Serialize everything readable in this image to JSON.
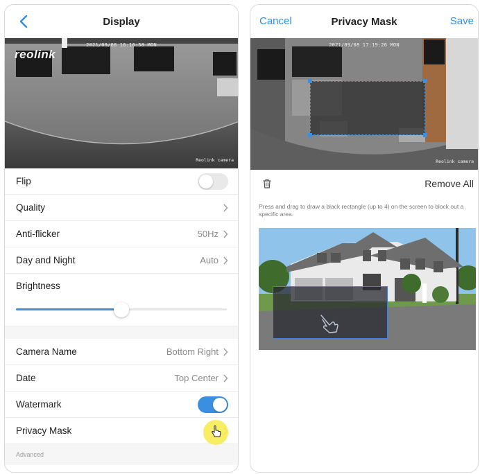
{
  "left": {
    "header": {
      "title": "Display"
    },
    "camera": {
      "timestamp": "2021/09/08 16:16:58 MON",
      "watermark": "Reolink camera",
      "logo": "reolink"
    },
    "rows": {
      "flip": {
        "label": "Flip",
        "state": "off"
      },
      "quality": {
        "label": "Quality"
      },
      "anti_flicker": {
        "label": "Anti-flicker",
        "value": "50Hz"
      },
      "day_night": {
        "label": "Day and Night",
        "value": "Auto"
      },
      "brightness": {
        "label": "Brightness",
        "level": 0.5
      },
      "camera_name": {
        "label": "Camera Name",
        "value": "Bottom Right"
      },
      "date": {
        "label": "Date",
        "value": "Top Center"
      },
      "watermark": {
        "label": "Watermark",
        "state": "on"
      },
      "privacy_mask": {
        "label": "Privacy Mask"
      }
    },
    "footer": "Advanced",
    "colors": {
      "accent": "#3b8fe0",
      "cursor_highlight": "#f7ec55"
    }
  },
  "right": {
    "header": {
      "title": "Privacy Mask",
      "cancel": "Cancel",
      "save": "Save"
    },
    "camera": {
      "timestamp": "2021/09/08 17:19:26 MON",
      "watermark": "Reolink camera"
    },
    "toolbar": {
      "remove_all": "Remove All"
    },
    "hint": "Press and drag to draw a black rectangle (up to 4) on the screen to block out a specific area."
  },
  "icons": [
    "chevron-left-icon",
    "chevron-right-icon",
    "trash-icon",
    "hand-pointer-icon",
    "drag-hand-icon"
  ]
}
